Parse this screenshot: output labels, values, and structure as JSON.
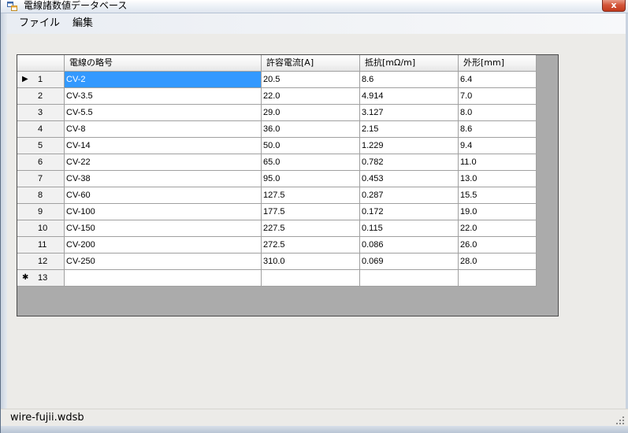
{
  "window": {
    "title": "電線諸数値データベース",
    "close_label": "x"
  },
  "menu": {
    "file": "ファイル",
    "edit": "編集"
  },
  "grid": {
    "columns": [
      "電線の略号",
      "許容電流[A]",
      "抵抗[mΩ/m]",
      "外形[mm]"
    ],
    "rows": [
      {
        "num": "1",
        "cells": [
          "CV-2",
          "20.5",
          "8.6",
          "6.4"
        ],
        "current": true
      },
      {
        "num": "2",
        "cells": [
          "CV-3.5",
          "22.0",
          "4.914",
          "7.0"
        ]
      },
      {
        "num": "3",
        "cells": [
          "CV-5.5",
          "29.0",
          "3.127",
          "8.0"
        ]
      },
      {
        "num": "4",
        "cells": [
          "CV-8",
          "36.0",
          "2.15",
          "8.6"
        ]
      },
      {
        "num": "5",
        "cells": [
          "CV-14",
          "50.0",
          "1.229",
          "9.4"
        ]
      },
      {
        "num": "6",
        "cells": [
          "CV-22",
          "65.0",
          "0.782",
          "11.0"
        ]
      },
      {
        "num": "7",
        "cells": [
          "CV-38",
          "95.0",
          "0.453",
          "13.0"
        ]
      },
      {
        "num": "8",
        "cells": [
          "CV-60",
          "127.5",
          "0.287",
          "15.5"
        ]
      },
      {
        "num": "9",
        "cells": [
          "CV-100",
          "177.5",
          "0.172",
          "19.0"
        ]
      },
      {
        "num": "10",
        "cells": [
          "CV-150",
          "227.5",
          "0.115",
          "22.0"
        ]
      },
      {
        "num": "11",
        "cells": [
          "CV-200",
          "272.5",
          "0.086",
          "26.0"
        ]
      },
      {
        "num": "12",
        "cells": [
          "CV-250",
          "310.0",
          "0.069",
          "28.0"
        ]
      },
      {
        "num": "13",
        "cells": [
          "",
          "",
          "",
          ""
        ],
        "new": true
      }
    ],
    "current_marker": "▶",
    "new_marker": "✱"
  },
  "status": {
    "text": "wire-fujii.wdsb"
  },
  "colors": {
    "selection": "#3399ff",
    "grid_background": "#ababab"
  },
  "icons": {
    "app": "app-window-icon",
    "close": "close-icon",
    "grip": "resize-grip-icon"
  }
}
